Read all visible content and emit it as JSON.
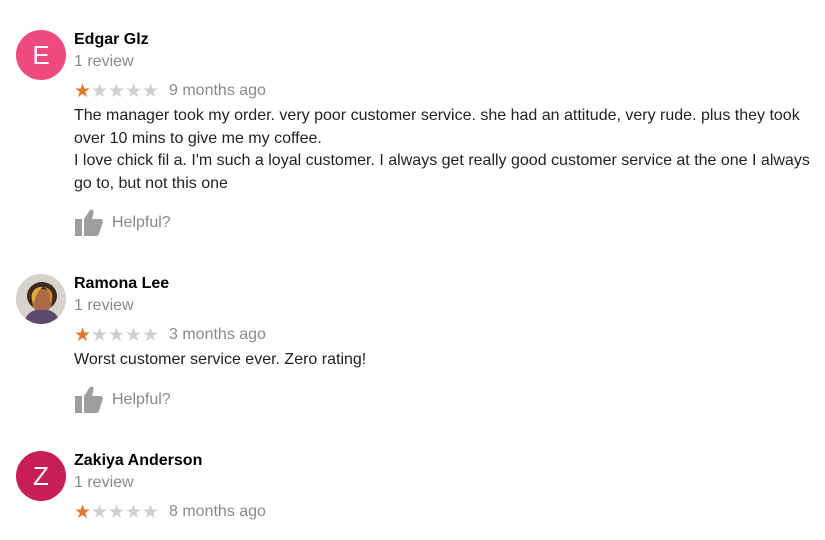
{
  "colors": {
    "star_filled": "#e0782d",
    "star_empty": "#cfcfcf",
    "avatar_edgar": "#ee4a7e",
    "avatar_zakiya": "#c71e59",
    "muted_text": "#8a8a8a"
  },
  "reviews": [
    {
      "avatar_letter": "E",
      "avatar_type": "letter",
      "name": "Edgar Glz",
      "review_count": "1 review",
      "rating": 1,
      "rating_max": 5,
      "time": "9 months ago",
      "text": "The manager took my order. very poor customer service. she had an attitude, very rude. plus they took over 10 mins to give me my coffee.\nI love chick fil a. I'm such a loyal customer.  I always get really good customer service at the one I always go to, but  not this one",
      "helpful_label": "Helpful?",
      "helpful_icon": "thumbs-up-icon"
    },
    {
      "avatar_letter": "",
      "avatar_type": "photo",
      "name": "Ramona Lee",
      "review_count": "1 review",
      "rating": 1,
      "rating_max": 5,
      "time": "3 months ago",
      "text": "Worst customer service ever. Zero rating!",
      "helpful_label": "Helpful?",
      "helpful_icon": "thumbs-up-icon"
    },
    {
      "avatar_letter": "Z",
      "avatar_type": "letter",
      "name": "Zakiya Anderson",
      "review_count": "1 review",
      "rating": 1,
      "rating_max": 5,
      "time": "8 months ago",
      "text": "",
      "helpful_label": "",
      "helpful_icon": ""
    }
  ]
}
